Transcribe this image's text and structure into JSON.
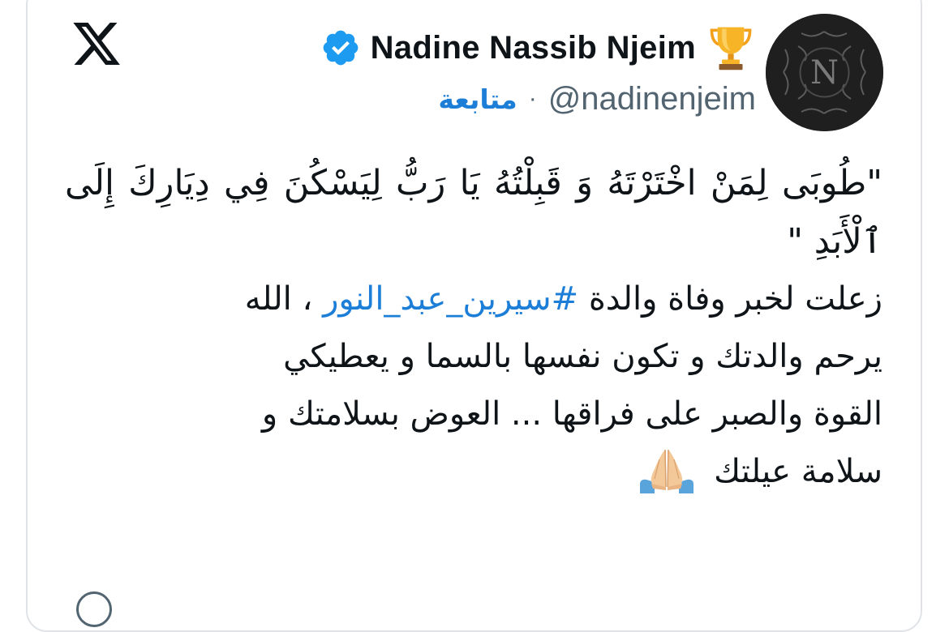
{
  "brand": {
    "icon": "x-logo-icon"
  },
  "author": {
    "display_name": "Nadine Nassib Njeim",
    "handle": "@nadinenjeim",
    "verified_icon": "verified-badge-icon",
    "badge_icon": "trophy-icon",
    "avatar_monogram": "N",
    "follow_label": "متابعة",
    "separator": "·"
  },
  "tweet": {
    "quote": "\"طُوبَى لِمَنْ اخْتَرْتَهُ وَ قَبِلْتُهُ يَا رَبُّ لِيَسْكُنَ فِي دِيَارِكَ إِلَى ٱلْأَبَدِ \"",
    "line1_before": "زعلت لخبر وفاة والدة ",
    "hashtag": "#سيرين_عبد_النور",
    "line1_after": "  ، الله",
    "rest": "يرحم والدتك و تكون نفسها بالسما و يعطيكي\nالقوة والصبر على فراقها ... العوض بسلامتك و\nسلامة عيلتك",
    "emoji": "folded-hands-icon"
  },
  "colors": {
    "link": "#1d7ed8",
    "verified": "#1d9bf0",
    "muted": "#536471",
    "border": "#dfe3e7"
  }
}
